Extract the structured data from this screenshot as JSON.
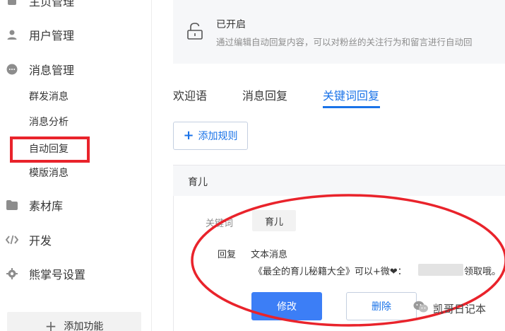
{
  "sidebar": {
    "top_partial_label": "主页管理",
    "items": [
      {
        "label": "用户管理",
        "icon": "user-icon"
      },
      {
        "label": "消息管理",
        "icon": "message-icon"
      },
      {
        "label": "素材库",
        "icon": "folder-icon"
      },
      {
        "label": "开发",
        "icon": "code-icon"
      },
      {
        "label": "熊掌号设置",
        "icon": "gear-icon"
      }
    ],
    "message_subitems": [
      "群发消息",
      "消息分析",
      "自动回复",
      "模版消息"
    ],
    "add_function_label": "添加功能"
  },
  "notice": {
    "status": "已开启",
    "description": "通过编辑自动回复内容，可以对粉丝的关注行为和留言进行自动回"
  },
  "tabs": [
    {
      "label": "欢迎语",
      "active": false
    },
    {
      "label": "消息回复",
      "active": false
    },
    {
      "label": "关键词回复",
      "active": true
    }
  ],
  "add_rule_label": "添加规则",
  "rule": {
    "name": "育儿",
    "keyword_label": "关键词",
    "keyword_value": "育儿",
    "reply_label": "回复",
    "reply_type": "文本消息",
    "reply_text_start": "《最全的育儿秘籍大全》可以+微❤：",
    "reply_text_end": "领取哦。"
  },
  "buttons": {
    "edit": "修改",
    "delete": "删除"
  },
  "watermark": "凯哥日记本",
  "colors": {
    "accent": "#1a73e8",
    "primary_button": "#3c7ef6",
    "highlight_red": "#e9232b"
  }
}
